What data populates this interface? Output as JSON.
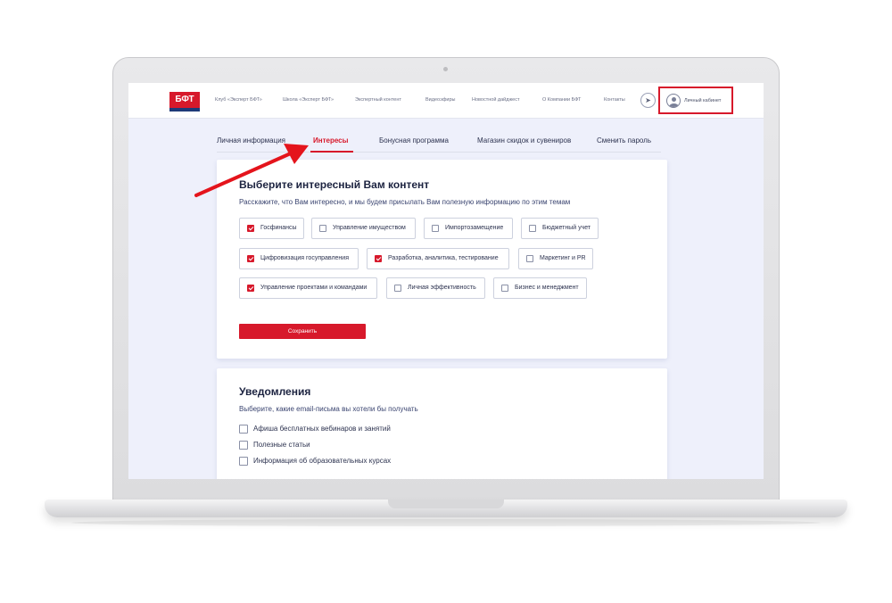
{
  "header": {
    "logo_text": "БФТ",
    "nav": [
      "Клуб «Эксперт БФТ»",
      "Школа «Эксперт БФТ»",
      "Экспертный контент",
      "Видеоэфиры",
      "Новостной дайджест",
      "О Компании БФТ",
      "Контакты"
    ],
    "account_label": "Личный кабинет"
  },
  "tabs": [
    {
      "label": "Личная информация",
      "active": false
    },
    {
      "label": "Интересы",
      "active": true
    },
    {
      "label": "Бонусная программа",
      "active": false
    },
    {
      "label": "Магазин скидок и сувениров",
      "active": false
    },
    {
      "label": "Сменить пароль",
      "active": false
    }
  ],
  "interests": {
    "title": "Выберите интересный Вам контент",
    "subtitle": "Расскажите, что Вам интересно, и мы будем присылать Вам полезную информацию по этим темам",
    "options": [
      {
        "label": "Госфинансы",
        "checked": true
      },
      {
        "label": "Управление имуществом",
        "checked": false
      },
      {
        "label": "Импортозамещение",
        "checked": false
      },
      {
        "label": "Бюджетный учет",
        "checked": false
      },
      {
        "label": "Цифровизация госуправления",
        "checked": true
      },
      {
        "label": "Разработка, аналитика, тестирование",
        "checked": true
      },
      {
        "label": "Маркетинг и PR",
        "checked": false
      },
      {
        "label": "Управление проектами и командами",
        "checked": true
      },
      {
        "label": "Личная эффективность",
        "checked": false
      },
      {
        "label": "Бизнес и менеджмент",
        "checked": false
      }
    ],
    "save_label": "Сохранить"
  },
  "notifications": {
    "title": "Уведомления",
    "subtitle": "Выберите, какие email-письма вы хотели бы получать",
    "options": [
      {
        "label": "Афиша бесплатных вебинаров и занятий",
        "checked": false
      },
      {
        "label": "Полезные статьи",
        "checked": false
      },
      {
        "label": "Информация об образовательных курсах",
        "checked": false
      }
    ]
  },
  "colors": {
    "accent": "#d7192b",
    "brand_blue": "#1e3a78",
    "page_bg": "#eef0fb"
  },
  "icons": [
    "telegram-icon",
    "user-avatar-icon",
    "checkbox-icon"
  ]
}
